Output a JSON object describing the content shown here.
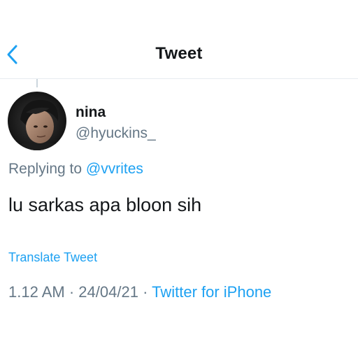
{
  "header": {
    "title": "Tweet",
    "back_icon": "chevron-left-icon",
    "accent_color": "#1da1f2"
  },
  "tweet": {
    "display_name": "nina",
    "handle": "@hyuckins_",
    "replying_prefix": "Replying to",
    "replying_to": "@vvrites",
    "text": "lu sarkas apa bloon sih",
    "translate_label": "Translate Tweet",
    "time": "1.12 AM",
    "separator": "·",
    "date": "24/04/21",
    "source": "Twitter for iPhone"
  }
}
